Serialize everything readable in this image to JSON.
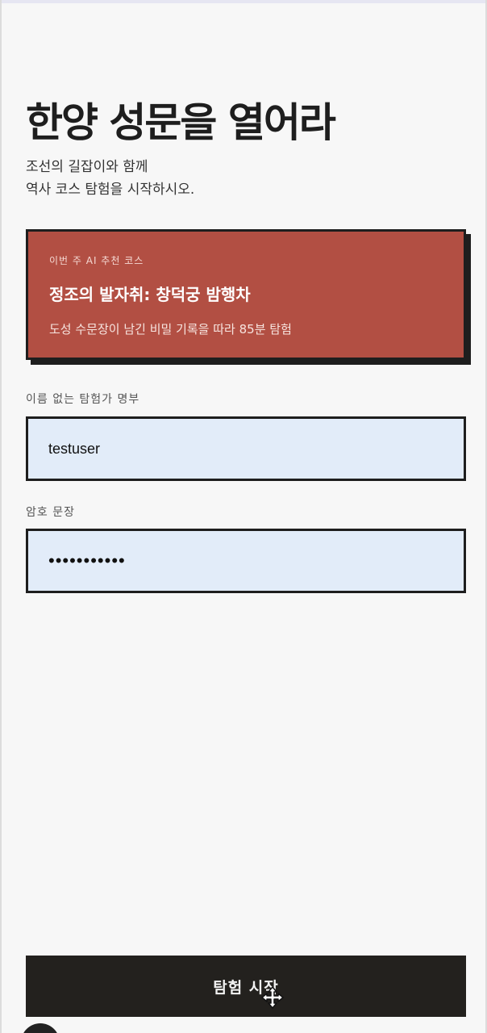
{
  "header": {
    "title": "한양 성문을 열어라",
    "subtitle_line1": "조선의 길잡이와 함께",
    "subtitle_line2": "역사 코스 탐험을 시작하시오."
  },
  "recommendation": {
    "eyebrow": "이번 주 AI 추천 코스",
    "title": "정조의 발자취: 창덕궁 밤행차",
    "description": "도성 수문장이 남긴 비밀 기록을 따라 85분 탐험"
  },
  "form": {
    "username_label": "이름 없는 탐험가 명부",
    "username_value": "testuser",
    "password_label": "암호 문장",
    "password_value": "•••••••••••"
  },
  "actions": {
    "start_label": "탐험 시작"
  },
  "colors": {
    "card_background": "#b24f43",
    "input_background": "#e2ecf9",
    "button_background": "#23211e"
  },
  "icons": {
    "cursor": "move-cursor-icon"
  }
}
